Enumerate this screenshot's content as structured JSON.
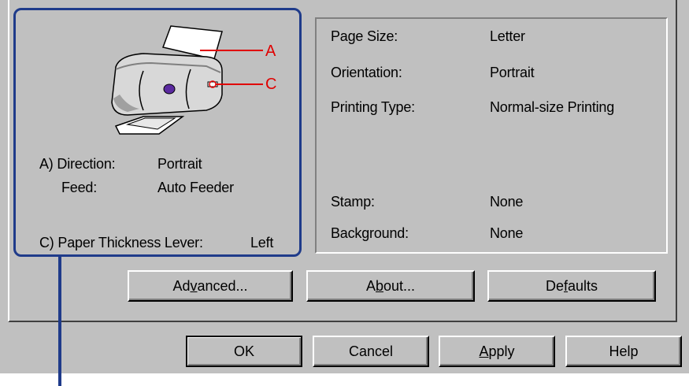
{
  "preview": {
    "label_a": "A",
    "label_c": "C",
    "direction_label": "A) Direction:",
    "direction_value": "Portrait",
    "feed_label": "Feed:",
    "feed_value": "Auto Feeder",
    "thickness_label": "C) Paper Thickness Lever:",
    "thickness_value": "Left"
  },
  "settings": {
    "page_size_label": "Page Size:",
    "page_size_value": "Letter",
    "orientation_label": "Orientation:",
    "orientation_value": "Portrait",
    "printing_type_label": "Printing Type:",
    "printing_type_value": "Normal-size Printing",
    "stamp_label": "Stamp:",
    "stamp_value": "None",
    "background_label": "Background:",
    "background_value": "None"
  },
  "tab_buttons": {
    "advanced_pre": "Ad",
    "advanced_u": "v",
    "advanced_post": "anced...",
    "about_pre": "A",
    "about_u": "b",
    "about_post": "out...",
    "defaults_pre": "De",
    "defaults_u": "f",
    "defaults_post": "aults"
  },
  "dialog_buttons": {
    "ok": "OK",
    "cancel": "Cancel",
    "apply_u": "A",
    "apply_post": "pply",
    "help": "Help"
  },
  "colors": {
    "face": "#c0c0c0",
    "highlight_frame": "#1f3b8a",
    "callout_red": "#e00000"
  }
}
